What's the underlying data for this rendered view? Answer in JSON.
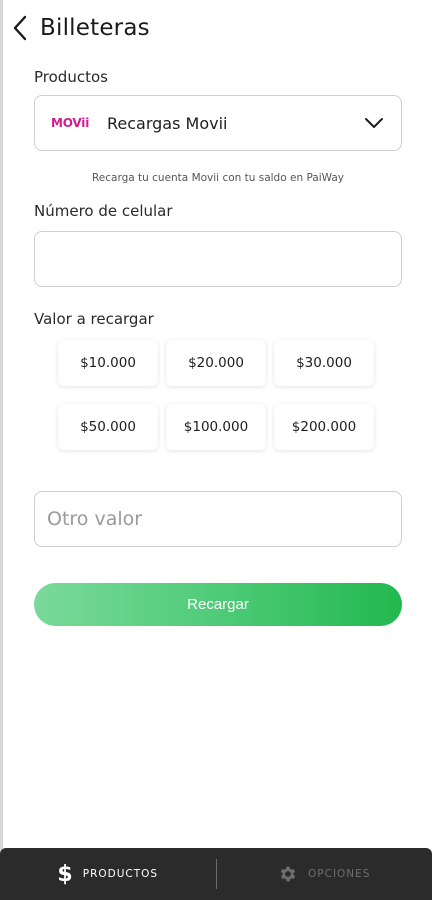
{
  "header": {
    "title": "Billeteras"
  },
  "productos": {
    "label": "Productos",
    "logo_text": "MOVii",
    "selected": "Recargas Movii",
    "helper": "Recarga tu cuenta Movii con tu saldo en PaiWay"
  },
  "celular": {
    "label": "Número de celular",
    "value": "",
    "placeholder": ""
  },
  "valor": {
    "label": "Valor a recargar",
    "amounts": [
      "$10.000",
      "$20.000",
      "$30.000",
      "$50.000",
      "$100.000",
      "$200.000"
    ]
  },
  "otro": {
    "placeholder": "Otro valor"
  },
  "action": {
    "recargar_label": "Recargar"
  },
  "bottom_nav": {
    "productos_label": "PRODUCTOS",
    "opciones_label": "OPCIONES"
  },
  "colors": {
    "brand_pink": "#d31b8c",
    "button_green": "#22b84e",
    "nav_bg": "#2b2b2b"
  }
}
